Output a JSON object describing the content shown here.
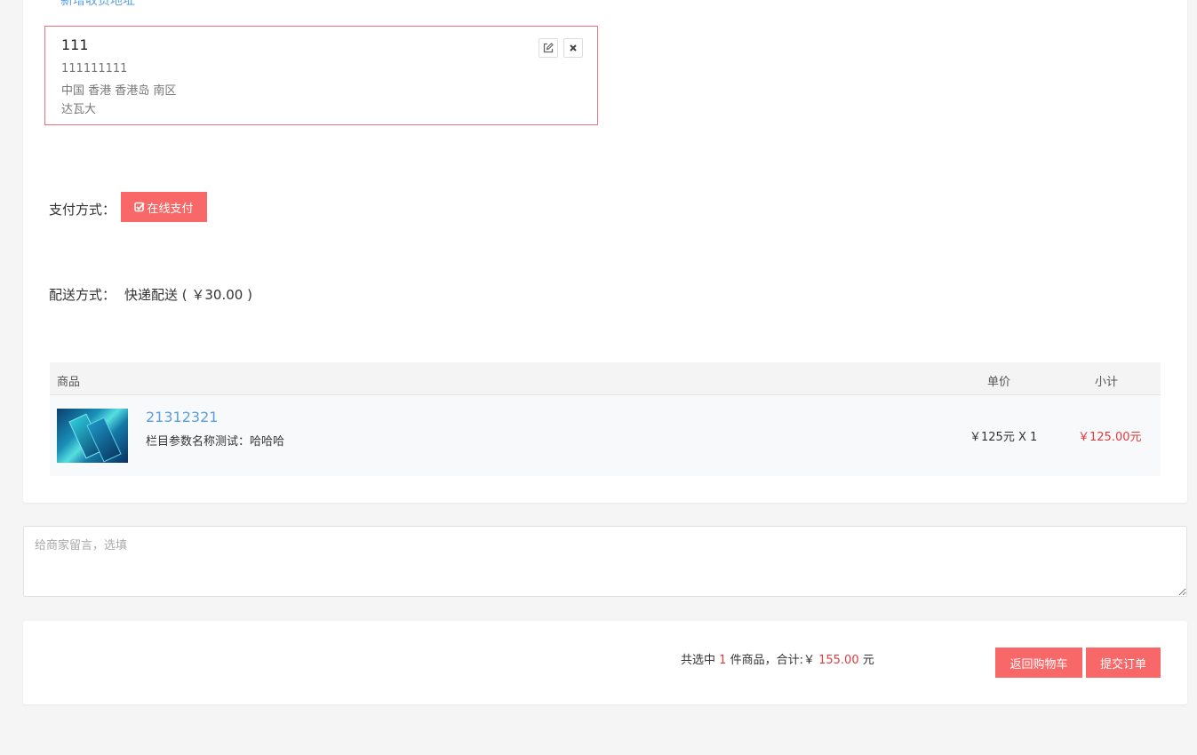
{
  "header": {
    "add_address_link": "新增收货地址"
  },
  "address": {
    "name": "111",
    "phone": "111111111",
    "region": "中国 香港 香港岛 南区",
    "detail": "达瓦大",
    "edit_icon": "edit-icon",
    "delete_icon": "close-icon"
  },
  "payment": {
    "label": "支付方式：",
    "option": "在线支付",
    "option_icon": "check-square-icon"
  },
  "shipping": {
    "label": "配送方式：",
    "method": "快递配送 ( ￥30.00 )"
  },
  "table": {
    "headers": {
      "product": "商品",
      "unit_price": "单价",
      "subtotal": "小计"
    },
    "rows": [
      {
        "name": "21312321",
        "attribute": "栏目参数名称测试：哈哈哈",
        "price_qty": "￥125元 X 1",
        "subtotal": "￥125.00元"
      }
    ]
  },
  "note": {
    "placeholder": "给商家留言，选填"
  },
  "summary": {
    "prefix": "共选中",
    "count": "1",
    "middle": "件商品，合计:￥",
    "total": "155.00",
    "suffix": "元"
  },
  "actions": {
    "back_label": "返回购物车",
    "submit_label": "提交订单"
  },
  "colors": {
    "accent": "#f96868",
    "price_red": "#e4393c",
    "link_blue": "#5aa0e0",
    "address_border": "#f2707a"
  }
}
